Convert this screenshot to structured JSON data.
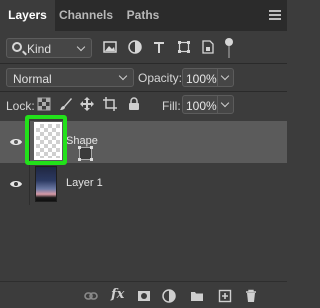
{
  "tabs": [
    {
      "label": "Layers",
      "active": true
    },
    {
      "label": "Channels",
      "active": false
    },
    {
      "label": "Paths",
      "active": false
    }
  ],
  "filter": {
    "kind_label": "Kind",
    "icons": [
      "image-filter-icon",
      "adjustment-filter-icon",
      "type-filter-icon",
      "shape-filter-icon",
      "smart-object-filter-icon",
      "filter-toggle-icon"
    ]
  },
  "blend": {
    "mode": "Normal",
    "opacity_label": "Opacity:",
    "opacity_value": "100%"
  },
  "lock": {
    "label": "Lock:",
    "fill_label": "Fill:",
    "fill_value": "100%"
  },
  "layers": [
    {
      "name": "Shape",
      "selected": true,
      "visible": true,
      "type": "shape"
    },
    {
      "name": "Layer 1",
      "selected": false,
      "visible": true,
      "type": "raster"
    }
  ],
  "bottom_icons": [
    "link-layers-icon",
    "fx-icon",
    "layer-mask-icon",
    "adjustment-layer-icon",
    "group-folder-icon",
    "new-layer-icon",
    "trash-icon"
  ],
  "colors": {
    "panel_bg": "#3c3c3c",
    "tabbar_bg": "#2b2b2b",
    "selected_row": "#5b5b5b",
    "highlight": "#22e11a"
  }
}
